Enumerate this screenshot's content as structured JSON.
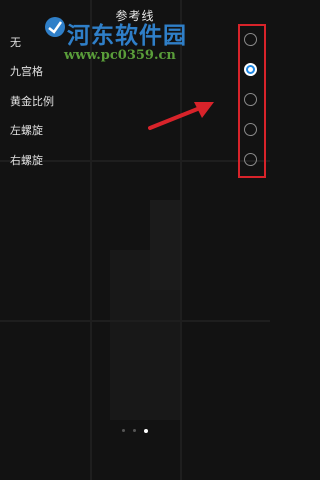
{
  "header": {
    "title": "参考线"
  },
  "options": [
    {
      "label": "无",
      "selected": false
    },
    {
      "label": "九宫格",
      "selected": true
    },
    {
      "label": "黄金比例",
      "selected": false
    },
    {
      "label": "左螺旋",
      "selected": false
    },
    {
      "label": "右螺旋",
      "selected": false
    }
  ],
  "watermark": {
    "name": "河东软件园",
    "url": "www.pc0359.cn"
  },
  "pager": {
    "pages": 3,
    "current": 3
  },
  "colors": {
    "highlight_box": "#d8232a",
    "radio_selected": "#1e88e5",
    "arrow": "#d8232a"
  }
}
